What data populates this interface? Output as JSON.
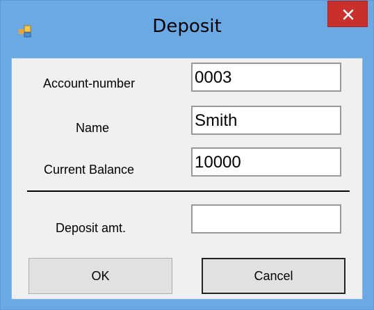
{
  "window": {
    "title": "Deposit",
    "close_label": "✕"
  },
  "form": {
    "account_number": {
      "label": "Account-number",
      "value": "0003"
    },
    "name": {
      "label": "Name",
      "value": "Smith"
    },
    "current_balance": {
      "label": "Current Balance",
      "value": "10000"
    },
    "deposit_amount": {
      "label": "Deposit amt.",
      "value": ""
    }
  },
  "buttons": {
    "ok_label": "OK",
    "cancel_label": "Cancel"
  },
  "colors": {
    "titlebar": "#6aa9e3",
    "close_button": "#c9302c",
    "client_background": "#f0f0f0"
  },
  "icons": {
    "app": "windows-form-icon",
    "close": "close-icon"
  }
}
